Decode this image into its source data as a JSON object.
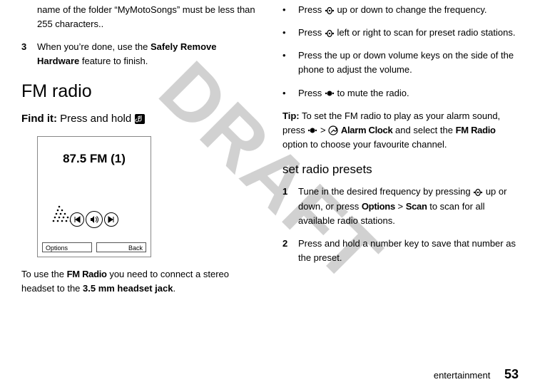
{
  "watermark": "DRAFT",
  "left": {
    "carryover": "name of the folder “MyMotoSongs” must be less than 255 characters..",
    "step3_num": "3",
    "step3_a": "When you’re done, use the ",
    "step3_b": "Safely Remove Hardware",
    "step3_c": " feature to finish.",
    "heading": "FM radio",
    "findit_label": "Find it:",
    "findit_text": " Press and hold ",
    "screen": {
      "freq": "87.5 FM (1)",
      "soft_left": "Options",
      "soft_right": "Back"
    },
    "below_a": "To use the ",
    "below_b": "FM Radio",
    "below_c": " you need to connect a stereo headset to the ",
    "below_d": "3.5 mm headset jack",
    "below_e": "."
  },
  "right": {
    "b1": "Press      up or down to change the frequency.",
    "b2": "Press      left or right to scan for preset radio stations.",
    "b3": "Press the up or down volume keys on the side of the phone to adjust the volume.",
    "b4_a": "Press ",
    "b4_b": " to mute the radio.",
    "tip_label": "Tip:",
    "tip_a": " To set the FM radio to play as your alarm sound, press ",
    "tip_gt": " > ",
    "tip_alarm": "Alarm Clock",
    "tip_b": " and select the ",
    "tip_fm": "FM Radio",
    "tip_c": " option to choose your favourite channel.",
    "sub": "set radio presets",
    "s1_num": "1",
    "s1_a": "Tune in the desired frequency by pressing      up or down, or press ",
    "s1_opt": "Options",
    "s1_gt": " > ",
    "s1_scan": "Scan",
    "s1_b": " to scan for all available radio stations.",
    "s2_num": "2",
    "s2": "Press and hold a number key to save that number as the preset."
  },
  "footer": {
    "section": "entertainment",
    "page": "53"
  }
}
